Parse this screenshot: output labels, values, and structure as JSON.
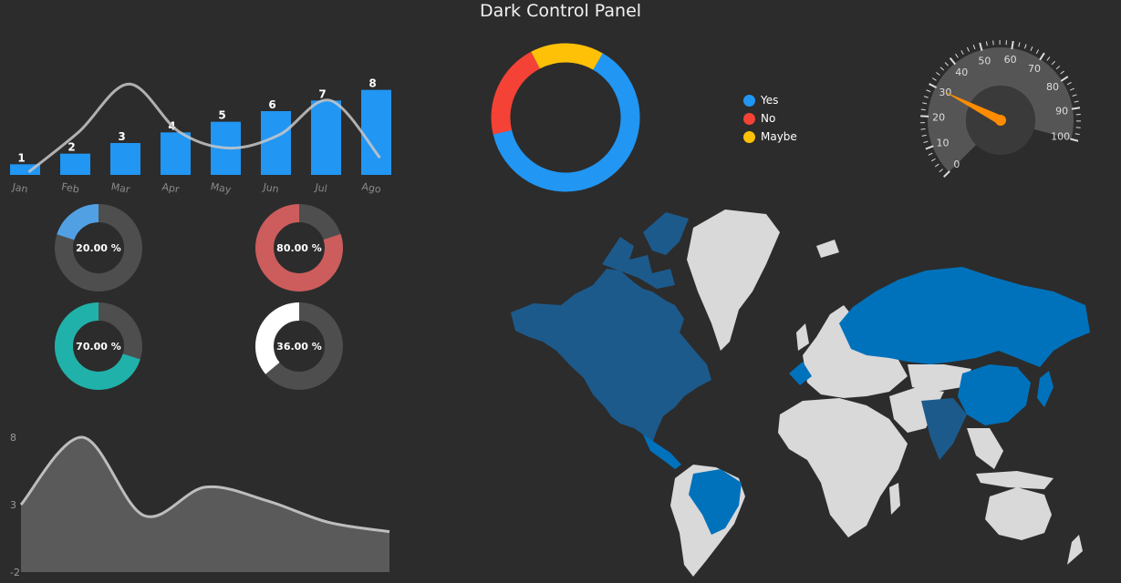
{
  "title": "Dark Control Panel",
  "colors": {
    "background": "#2c2c2c",
    "bar": "#2196f3",
    "line": "#c8c8c8",
    "track": "#4e4e4e",
    "area_fill": "#5a5a5a",
    "gauge_face": "#555555",
    "gauge_needle": "#ff8c00",
    "map_land": "#d9d9d9",
    "map_highlight": "#0072bc",
    "map_dark_highlight": "#1c5a8c"
  },
  "chart_data": [
    {
      "type": "bar",
      "categories": [
        "Jan",
        "Feb",
        "Mar",
        "Apr",
        "May",
        "Jun",
        "Jul",
        "Ago"
      ],
      "values": [
        1,
        2,
        3,
        4,
        5,
        6,
        7,
        8
      ],
      "line_values": [
        0.3,
        4.5,
        9.5,
        4.5,
        2.8,
        4.2,
        7.8,
        1.8
      ],
      "ylim": [
        0,
        9
      ]
    },
    {
      "type": "pie",
      "labels": [
        "20.00 %",
        "80.00 %",
        "70.00 %",
        "36.00 %"
      ],
      "values": [
        0.2,
        0.8,
        0.7,
        0.36
      ],
      "colors": [
        "#52a0e4",
        "#cd5c5c",
        "#20b2aa",
        "#ffffff"
      ]
    },
    {
      "type": "area",
      "x": [
        0,
        1,
        2,
        3,
        4,
        5,
        6
      ],
      "values": [
        3,
        8,
        2.2,
        4.3,
        3.3,
        1.7,
        1
      ],
      "yticks": [
        "8",
        "3",
        "-2"
      ],
      "ylim": [
        -2,
        8
      ]
    },
    {
      "type": "pie",
      "labels": [
        "Yes",
        "No",
        "Maybe"
      ],
      "values": [
        63,
        21,
        16
      ],
      "colors": [
        "#2196f3",
        "#f44336",
        "#ffc107"
      ]
    },
    {
      "type": "gauge",
      "value": 30,
      "min": 0,
      "max": 100,
      "ticks": [
        "0",
        "10",
        "20",
        "30",
        "40",
        "50",
        "60",
        "70",
        "80",
        "90",
        "100"
      ]
    }
  ]
}
